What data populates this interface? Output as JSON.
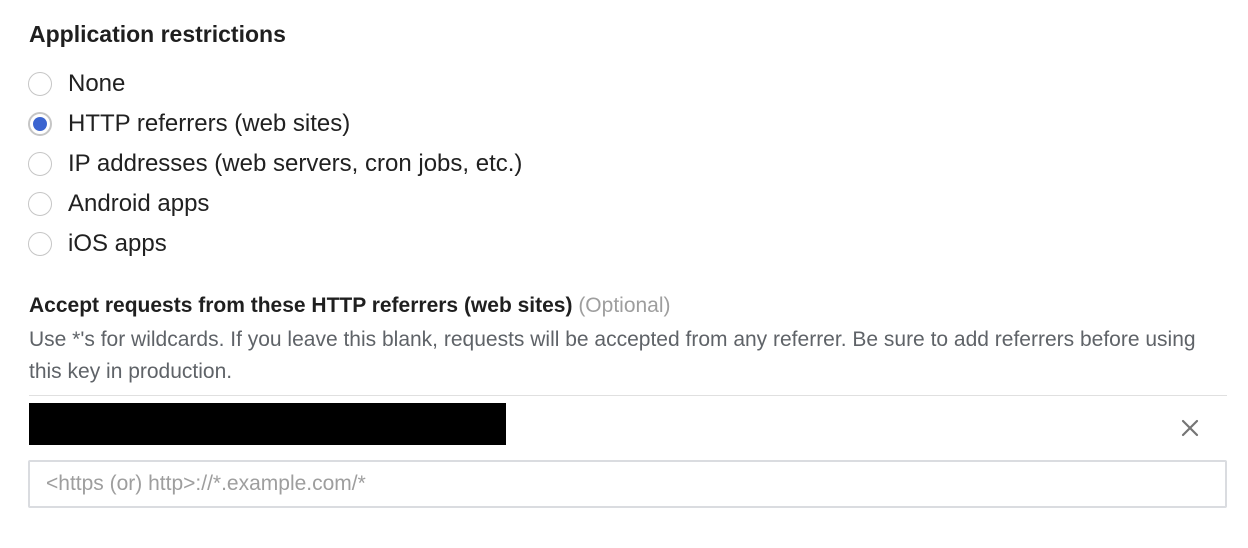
{
  "application_restrictions": {
    "title": "Application restrictions",
    "options": [
      {
        "label": "None",
        "checked": false
      },
      {
        "label": "HTTP referrers (web sites)",
        "checked": true
      },
      {
        "label": "IP addresses (web servers, cron jobs, etc.)",
        "checked": false
      },
      {
        "label": "Android apps",
        "checked": false
      },
      {
        "label": "iOS apps",
        "checked": false
      }
    ],
    "selected_color": "#3b64d0"
  },
  "referrers": {
    "heading": "Accept requests from these HTTP referrers (web sites)",
    "optional_label": "(Optional)",
    "help_text": "Use *'s for wildcards. If you leave this blank, requests will be accepted from any referrer. Be sure to add referrers before using this key in production.",
    "entries": [
      {
        "value": "",
        "redacted": true,
        "remove_icon": "close-icon"
      }
    ],
    "new_referrer_value": "",
    "new_referrer_placeholder": "<https (or) http>://*.example.com/*"
  }
}
